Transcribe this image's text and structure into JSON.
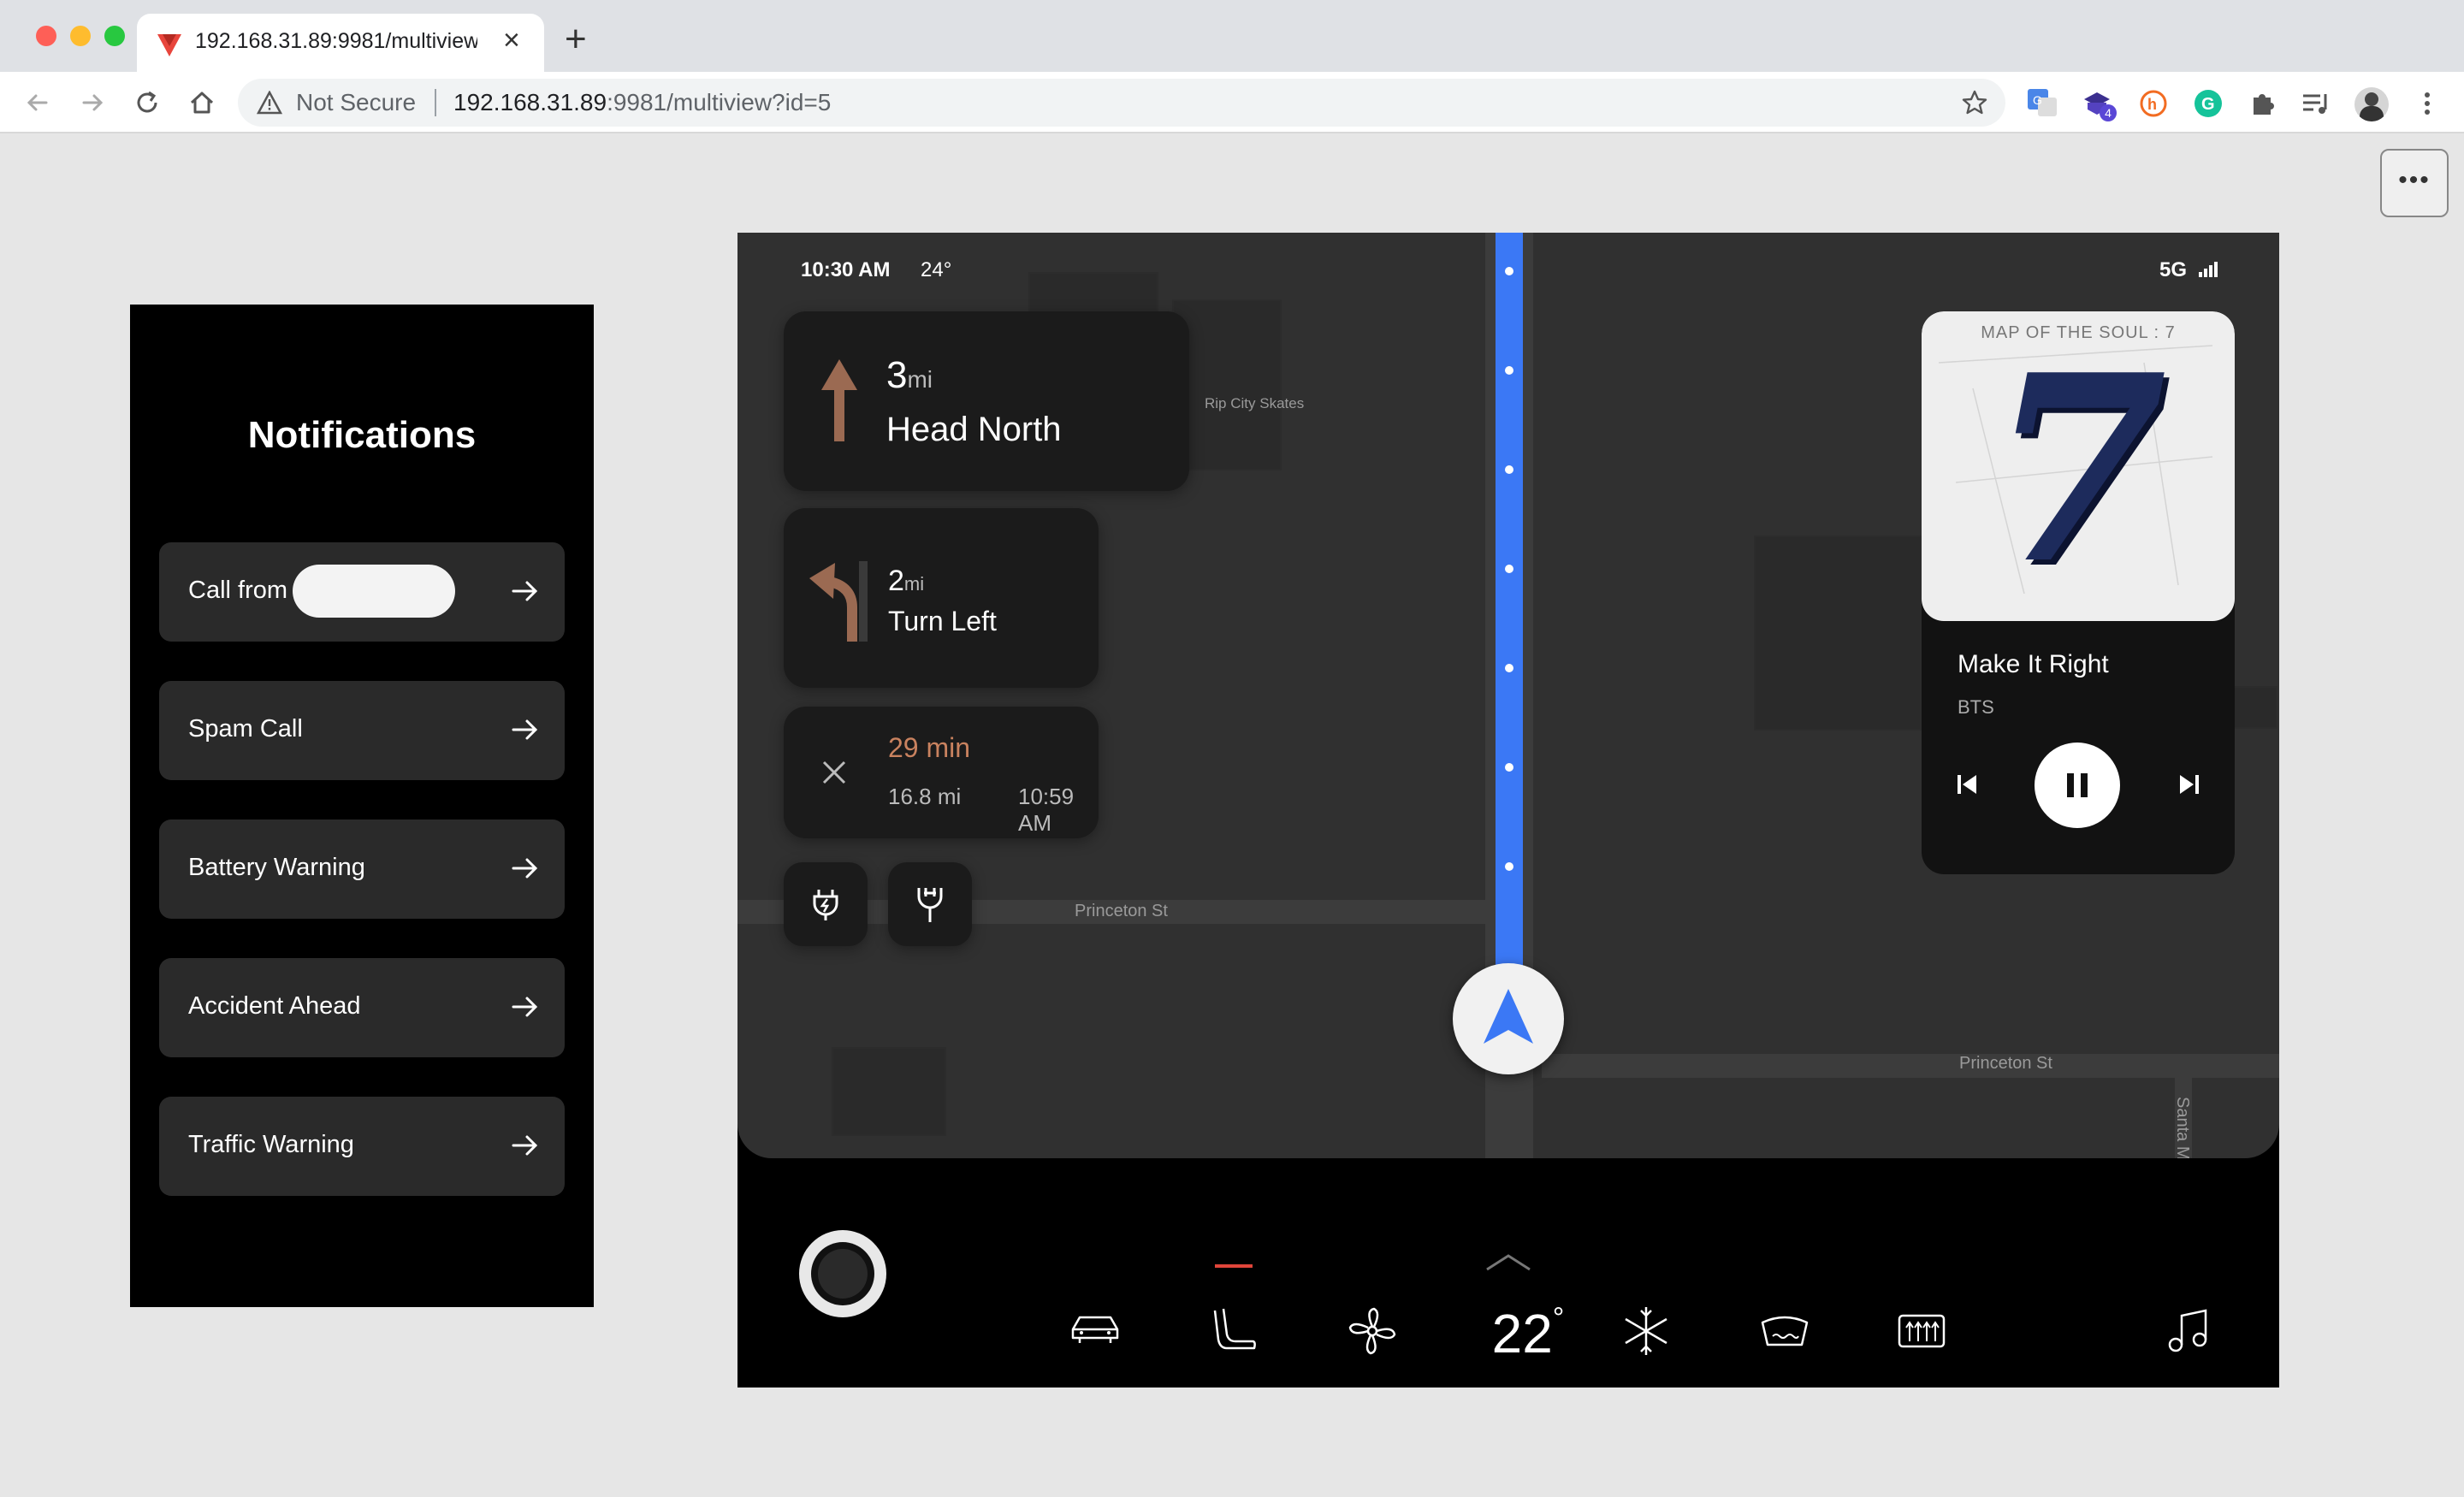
{
  "browser": {
    "tab_title": "192.168.31.89:9981/multiview?id=5",
    "security_label": "Not Secure",
    "url_host": "192.168.31.89",
    "url_rest": ":9981/multiview?id=5",
    "extension_badge": "4",
    "more_label": "•••"
  },
  "notifications": {
    "title": "Notifications",
    "items": [
      {
        "label": "Call from"
      },
      {
        "label": "Spam Call"
      },
      {
        "label": "Battery Warning"
      },
      {
        "label": "Accident Ahead"
      },
      {
        "label": "Traffic Warning"
      }
    ]
  },
  "status_bar": {
    "time": "10:30 AM",
    "temperature": "24°",
    "network": "5G"
  },
  "map": {
    "labels": [
      "Rip City Skates",
      "Princeton St",
      "Princeton St",
      "Santa M"
    ]
  },
  "navigation": {
    "primary": {
      "distance": "3",
      "unit": "mi",
      "instruction": "Head North"
    },
    "secondary": {
      "distance": "2",
      "unit": "mi",
      "instruction": "Turn Left"
    },
    "eta": {
      "duration": "29 min",
      "distance": "16.8 mi",
      "arrival": "10:59 AM"
    }
  },
  "music": {
    "album_title": "MAP OF THE SOUL : 7",
    "album_art_numeral": "7",
    "song": "Make It Right",
    "artist": "BTS"
  },
  "climate": {
    "temperature": "22",
    "degree": "°"
  },
  "colors": {
    "route": "#3b78f5",
    "nav_arrow": "#9b6a52",
    "eta": "#c9825f",
    "heat_red": "#e0453a",
    "seat_blue": "#3b6fd8"
  }
}
